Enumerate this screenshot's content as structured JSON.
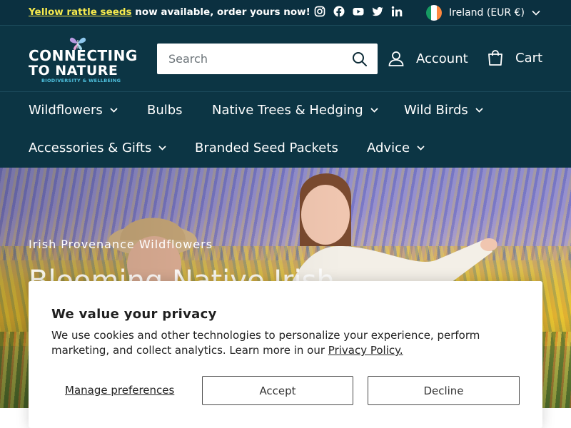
{
  "announcement": {
    "link_text": "Yellow rattle seeds",
    "rest_text": " now available, order yours now!"
  },
  "social": [
    "instagram-icon",
    "facebook-icon",
    "youtube-icon",
    "twitter-icon",
    "linkedin-icon"
  ],
  "locale": {
    "label": "Ireland (EUR €)",
    "flag_colors": [
      "#169b62",
      "#ffffff",
      "#ff883e"
    ]
  },
  "logo": {
    "line1": "CONNECTING",
    "line2": "TO NATURE",
    "tagline": "BIODIVERSITY & WELLBEING"
  },
  "search": {
    "placeholder": "Search"
  },
  "header": {
    "account_label": "Account",
    "cart_label": "Cart"
  },
  "nav": {
    "items": [
      {
        "label": "Wildflowers",
        "dropdown": true
      },
      {
        "label": "Bulbs",
        "dropdown": false
      },
      {
        "label": "Native Trees & Hedging",
        "dropdown": true
      },
      {
        "label": "Wild Birds",
        "dropdown": true
      },
      {
        "label": "Accessories & Gifts",
        "dropdown": true
      },
      {
        "label": "Branded Seed Packets",
        "dropdown": false
      },
      {
        "label": "Advice",
        "dropdown": true
      }
    ]
  },
  "hero": {
    "eyebrow": "Irish Provenance Wildflowers",
    "title": "Blooming Native Irish"
  },
  "cookie": {
    "title": "We value your privacy",
    "body": "We use cookies and other technologies to personalize your experience, perform marketing, and collect analytics. Learn more in our ",
    "policy_link": "Privacy Policy.",
    "manage_label": "Manage preferences",
    "accept_label": "Accept",
    "decline_label": "Decline"
  },
  "colors": {
    "header_bg": "#0c3544",
    "announce_bg": "#0b3040",
    "announce_link": "#f5e94d",
    "logo_accent": "#4ec1de"
  }
}
